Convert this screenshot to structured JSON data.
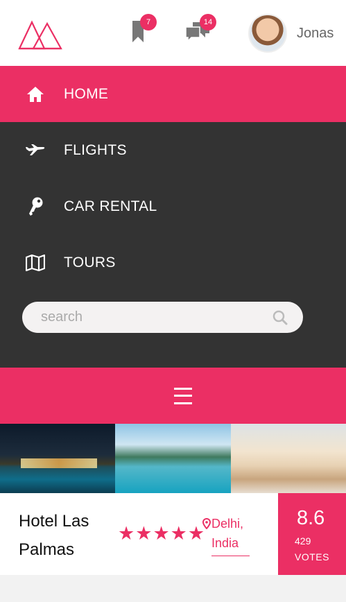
{
  "header": {
    "logo_icon": "mountain-triangles-logo",
    "bookmarks": {
      "icon": "bookmark-icon",
      "count": "7"
    },
    "messages": {
      "icon": "chat-icon",
      "count": "14"
    },
    "user": {
      "name": "Jonas",
      "avatar": "avatar"
    }
  },
  "nav": {
    "items": [
      {
        "label": "HOME",
        "icon": "home-icon",
        "active": true
      },
      {
        "label": "FLIGHTS",
        "icon": "plane-icon",
        "active": false
      },
      {
        "label": "CAR RENTAL",
        "icon": "key-icon",
        "active": false
      },
      {
        "label": "TOURS",
        "icon": "map-icon",
        "active": false
      }
    ],
    "search": {
      "placeholder": "search",
      "icon": "search-icon"
    }
  },
  "menu": {
    "icon": "hamburger-icon"
  },
  "hotel": {
    "name": "Hotel Las Palmas",
    "stars": 5,
    "location": "Delhi, India",
    "rating": "8.6",
    "votes_count": "429",
    "votes_label": "VOTES"
  },
  "colors": {
    "accent": "#eb2f64",
    "nav_bg": "#333333"
  }
}
